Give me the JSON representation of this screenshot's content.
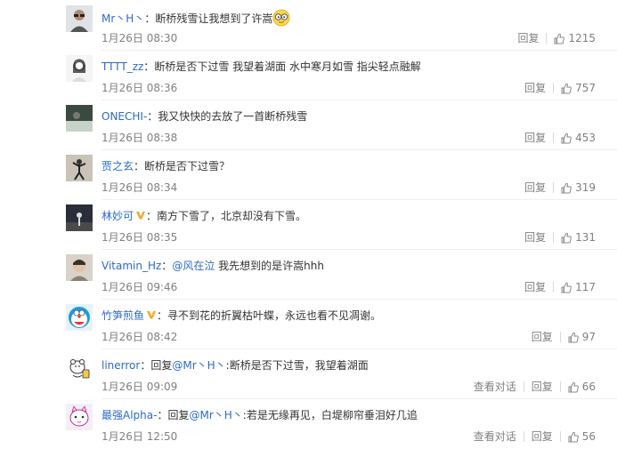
{
  "comments": [
    {
      "user": "Mr丶H丶",
      "name_color": "blue",
      "verified": false,
      "text": "断桥残雪让我想到了许嵩",
      "mention": "",
      "emoji": true,
      "time": "1月26日 08:30",
      "view_convo": "",
      "reply": "回复",
      "likes": "1215",
      "avatar": "person-glasses"
    },
    {
      "user": "TTTT_zz",
      "name_color": "blue",
      "verified": false,
      "text": "断桥是否下过雪 我望着湖面 水中寒月如雪 指尖轻点融解",
      "mention": "",
      "emoji": false,
      "time": "1月26日 08:36",
      "view_convo": "",
      "reply": "回复",
      "likes": "757",
      "avatar": "girl-sketch"
    },
    {
      "user": "ONECHI-",
      "name_color": "blue",
      "verified": false,
      "text": "我又快快的去放了一首断桥残雪",
      "mention": "",
      "emoji": false,
      "time": "1月26日 08:38",
      "view_convo": "",
      "reply": "回复",
      "likes": "453",
      "avatar": "dark-photo"
    },
    {
      "user": "贾之玄",
      "name_color": "blue",
      "verified": false,
      "text": "断桥是否下过雪？",
      "mention": "",
      "emoji": false,
      "time": "1月26日 08:34",
      "view_convo": "",
      "reply": "回复",
      "likes": "319",
      "avatar": "dancer"
    },
    {
      "user": "林妙可",
      "name_color": "blue",
      "verified": true,
      "text": "南方下雪了，北京却没有下雪。",
      "mention": "",
      "emoji": false,
      "time": "1月26日 08:35",
      "view_convo": "",
      "reply": "回复",
      "likes": "131",
      "avatar": "stage"
    },
    {
      "user": "Vitamin_Hz",
      "name_color": "blue",
      "verified": false,
      "text": " 我先想到的是许嵩hhh",
      "mention": "@风在泣",
      "emoji": false,
      "time": "1月26日 09:46",
      "view_convo": "",
      "reply": "回复",
      "likes": "117",
      "avatar": "face"
    },
    {
      "user": "竹笋煎鱼",
      "name_color": "blue",
      "verified": true,
      "text": "寻不到花的折翼枯叶蝶，永远也看不见凋谢。",
      "mention": "",
      "emoji": false,
      "time": "1月26日 08:42",
      "view_convo": "",
      "reply": "回复",
      "likes": "97",
      "avatar": "doraemon"
    },
    {
      "user": "linerror",
      "name_color": "blue",
      "verified": false,
      "text": ":断桥是否下过雪，我望着湖面",
      "mention": "@Mr丶H丶",
      "prefix": "回复",
      "emoji": false,
      "time": "1月26日 09:09",
      "view_convo": "查看对话",
      "reply": "回复",
      "likes": "66",
      "avatar": "bear"
    },
    {
      "user": "最强Alpha-",
      "name_color": "blue",
      "verified": false,
      "text": ":若是无缘再见，白堤柳帘垂泪好几追",
      "mention": "@Mr丶H丶",
      "prefix": "回复",
      "emoji": false,
      "time": "1月26日 12:50",
      "view_convo": "查看对话",
      "reply": "回复",
      "likes": "56",
      "avatar": "cat"
    }
  ],
  "colors": {
    "username": "#2b6ac5",
    "mention": "#2b6ac5",
    "meta": "#808080",
    "verified": "#f5a623"
  }
}
